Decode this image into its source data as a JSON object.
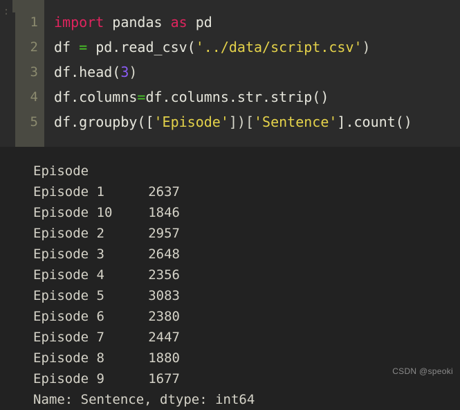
{
  "cell": {
    "prompt_marker": ":",
    "line_numbers": [
      "1",
      "2",
      "3",
      "4",
      "5"
    ],
    "code_lines": [
      {
        "number": "1",
        "text": "import pandas as pd",
        "tokens": [
          {
            "t": "import",
            "k": "kw"
          },
          {
            "t": " ",
            "k": "pun"
          },
          {
            "t": "pandas",
            "k": "id"
          },
          {
            "t": " ",
            "k": "pun"
          },
          {
            "t": "as",
            "k": "kw"
          },
          {
            "t": " ",
            "k": "pun"
          },
          {
            "t": "pd",
            "k": "id"
          }
        ]
      },
      {
        "number": "2",
        "text": "df = pd.read_csv('../data/script.csv')",
        "tokens": [
          {
            "t": "df ",
            "k": "id"
          },
          {
            "t": "=",
            "k": "op"
          },
          {
            "t": " pd.read_csv(",
            "k": "id"
          },
          {
            "t": "'../data/script.csv'",
            "k": "str"
          },
          {
            "t": ")",
            "k": "pun"
          }
        ]
      },
      {
        "number": "3",
        "text": "df.head(3)",
        "tokens": [
          {
            "t": "df.head(",
            "k": "id"
          },
          {
            "t": "3",
            "k": "num"
          },
          {
            "t": ")",
            "k": "pun"
          }
        ]
      },
      {
        "number": "4",
        "text": "df.columns=df.columns.str.strip()",
        "tokens": [
          {
            "t": "df.columns",
            "k": "id"
          },
          {
            "t": "=",
            "k": "op"
          },
          {
            "t": "df.columns.str.strip()",
            "k": "id"
          }
        ]
      },
      {
        "number": "5",
        "text": "df.groupby(['Episode'])['Sentence'].count()",
        "tokens": [
          {
            "t": "df.groupby([",
            "k": "id"
          },
          {
            "t": "'Episode'",
            "k": "str"
          },
          {
            "t": "])[",
            "k": "pun"
          },
          {
            "t": "'Sentence'",
            "k": "str"
          },
          {
            "t": "].count()",
            "k": "id"
          }
        ]
      }
    ]
  },
  "output": {
    "header": "Episode",
    "rows": [
      {
        "label": "Episode 1",
        "value": "2637"
      },
      {
        "label": "Episode 10",
        "value": "1846"
      },
      {
        "label": "Episode 2",
        "value": "2957"
      },
      {
        "label": "Episode 3",
        "value": "2648"
      },
      {
        "label": "Episode 4",
        "value": "2356"
      },
      {
        "label": "Episode 5",
        "value": "3083"
      },
      {
        "label": "Episode 6",
        "value": "2380"
      },
      {
        "label": "Episode 7",
        "value": "2447"
      },
      {
        "label": "Episode 8",
        "value": "1880"
      },
      {
        "label": "Episode 9",
        "value": "1677"
      }
    ],
    "footer": "Name: Sentence, dtype: int64"
  },
  "watermark": {
    "text": "CSDN @speoki"
  },
  "colors": {
    "code_background": "#2b2b2b",
    "output_background": "#222222",
    "gutter": "#4a4a42",
    "line_number": "#8c8b6f",
    "keyword": "#e0245e",
    "string": "#e4d24a",
    "operator": "#49c627",
    "number": "#8b5cf6",
    "identifier": "#e6e6dc",
    "output_text": "#d5d3c8",
    "watermark": "#8b8b8b"
  }
}
